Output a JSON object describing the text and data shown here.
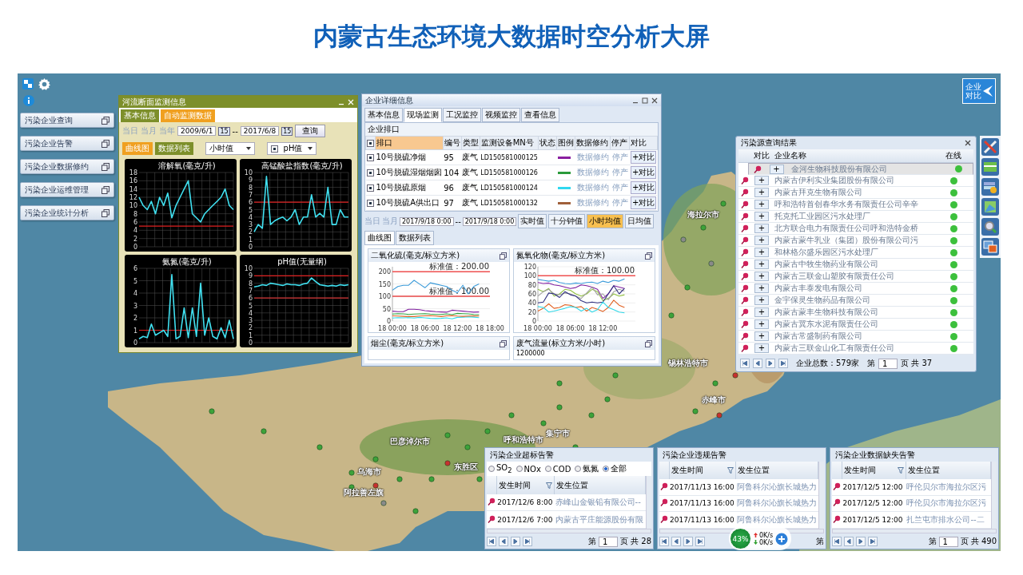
{
  "title": "内蒙古生态环境大数据时空分析大屏",
  "sidebar": {
    "items": [
      {
        "label": "污染企业查询"
      },
      {
        "label": "污染企业告警"
      },
      {
        "label": "污染企业数据修约"
      },
      {
        "label": "污染企业运维管理"
      },
      {
        "label": "污染企业统计分析"
      }
    ]
  },
  "compare_button": {
    "label": "企业对比"
  },
  "map": {
    "labels": [
      "海拉尔市",
      "锡林浩特市",
      "赤峰市",
      "巴彦淖尔市",
      "呼和浩特市",
      "集宁市",
      "东胜区",
      "乌海市",
      "阿拉善左旗"
    ]
  },
  "monitor_window": {
    "title": "河流断面监测信息",
    "tabs": [
      {
        "label": "基本信息",
        "selected": false
      },
      {
        "label": "自动监测数据",
        "selected": true
      }
    ],
    "period_links": [
      "当日",
      "当月",
      "当年"
    ],
    "start_date": "2009/6/1",
    "start_calendar_day": "15",
    "separator": "--",
    "end_date": "2017/6/8",
    "end_calendar_day": "15",
    "query_button": "查询",
    "view_tabs": [
      {
        "label": "曲线图",
        "selected": true
      },
      {
        "label": "数据列表",
        "selected": false
      }
    ],
    "interval_select": "小时值",
    "param_select": {
      "label": "pH值",
      "checked": true
    },
    "charts": [
      {
        "chart_data": {
          "type": "line",
          "title": "溶解氧(毫克/升)",
          "grid": true,
          "ylim": [
            0,
            18
          ],
          "yticks": [
            0,
            2,
            4,
            6,
            8,
            10,
            12,
            14,
            16,
            18
          ],
          "ref_lines": [
            {
              "axis": "y",
              "value": 5
            }
          ],
          "series": [
            {
              "color": "#40e0f0",
              "values": [
                12,
                10,
                9,
                11,
                8,
                12,
                10,
                13,
                7,
                10,
                12,
                14,
                16,
                8,
                7,
                6,
                8,
                9,
                10,
                11,
                12,
                14,
                10,
                9
              ]
            }
          ]
        }
      },
      {
        "chart_data": {
          "type": "line",
          "title": "高锰酸盐指数(毫克/升)",
          "grid": true,
          "ylim": [
            0,
            10
          ],
          "yticks": [
            0,
            1,
            2,
            3,
            4,
            5,
            6,
            7,
            8,
            9,
            10
          ],
          "ref_lines": [
            {
              "axis": "y",
              "value": 6
            }
          ],
          "series": [
            {
              "color": "#40e0f0",
              "values": [
                2,
                3,
                2.5,
                9.5,
                3,
                3.5,
                3.8,
                4,
                3.5,
                4,
                5,
                3,
                4,
                4,
                7,
                4,
                4.5,
                4,
                8,
                3,
                3,
                5,
                4,
                4
              ]
            }
          ]
        }
      },
      {
        "chart_data": {
          "type": "line",
          "title": "氨氮(毫克/升)",
          "grid": true,
          "ylim": [
            0,
            6
          ],
          "yticks": [
            0,
            1,
            2,
            3,
            4,
            5,
            6
          ],
          "ref_lines": [
            {
              "axis": "y",
              "value": 1
            }
          ],
          "series": [
            {
              "color": "#40e0f0",
              "values": [
                0.3,
                0.5,
                0.4,
                1.5,
                0.6,
                0.8,
                1,
                0.5,
                5.5,
                0.3,
                0.5,
                2.8,
                0.4,
                2.8,
                0.5,
                4.8,
                0.6,
                2,
                0.5,
                0.3,
                1.2,
                0.4,
                1.8,
                0.3
              ]
            }
          ]
        }
      },
      {
        "chart_data": {
          "type": "line",
          "title": "pH值(无量纲)",
          "grid": true,
          "ylim": [
            0,
            10
          ],
          "yticks": [
            0,
            1,
            2,
            3,
            4,
            5,
            6,
            7,
            8,
            9,
            10
          ],
          "ref_lines": [
            {
              "axis": "y",
              "value": 6
            },
            {
              "axis": "y",
              "value": 9
            }
          ],
          "series": [
            {
              "color": "#40e0f0",
              "values": [
                7.5,
                7.6,
                7.8,
                7.7,
                8,
                7.9,
                7.8,
                7.7,
                7.9,
                7.8,
                7.8,
                7.7,
                7.9,
                8,
                8.7,
                8.2,
                7.8,
                7.7,
                7.6,
                7.7,
                7.6,
                7.8,
                7.7,
                7.8
              ]
            }
          ]
        }
      }
    ]
  },
  "enterprise_window": {
    "title": "企业详细信息",
    "tabs": [
      {
        "label": "基本信息",
        "selected": false
      },
      {
        "label": "现场监测",
        "selected": true
      },
      {
        "label": "工况监控",
        "selected": false
      },
      {
        "label": "视频监控",
        "selected": false
      },
      {
        "label": "查看信息",
        "selected": false
      }
    ],
    "outlet_title": "企业排口",
    "header_checked": true,
    "columns": [
      "排口",
      "编号",
      "类型",
      "监测设备MN号",
      "状态",
      "图例",
      "数据修约",
      "停产",
      "对比"
    ],
    "rows": [
      {
        "checked": true,
        "outlet": "10号脱硫净烟",
        "code": "95",
        "type": "废气",
        "mn": "LD150581000125",
        "color": "#8a1fa0",
        "repair": "数据修约",
        "stop": "停产",
        "compare": "+对比"
      },
      {
        "checked": true,
        "outlet": "10号脱硫湿烟烟囱",
        "code": "104",
        "type": "废气",
        "mn": "LD150581000126",
        "color": "#2a9a3a",
        "repair": "数据修约",
        "stop": "停产",
        "compare": "+对比"
      },
      {
        "checked": true,
        "outlet": "10号脱硫原烟",
        "code": "96",
        "type": "废气",
        "mn": "LD150581000124",
        "color": "#30d8f0",
        "repair": "数据修约",
        "stop": "停产",
        "compare": "+对比"
      },
      {
        "checked": true,
        "outlet": "10号脱硫A供出口",
        "code": "97",
        "type": "废气",
        "mn": "LD150581000132",
        "color": "#a0603a",
        "repair": "数据修约",
        "stop": "停产",
        "compare": "+对比"
      }
    ],
    "period_links": [
      "当日",
      "当月"
    ],
    "start_date": "2017/9/18 0:00",
    "separator": "--",
    "end_date": "2017/9/18 0:00",
    "interval_buttons": [
      {
        "label": "实时值",
        "selected": false
      },
      {
        "label": "十分钟值",
        "selected": false
      },
      {
        "label": "小时均值",
        "selected": true
      },
      {
        "label": "日均值",
        "selected": false
      }
    ],
    "view_tabs": [
      {
        "label": "曲线图",
        "selected": true
      },
      {
        "label": "数据列表",
        "selected": false
      }
    ],
    "charts": [
      {
        "chart_data": {
          "type": "line",
          "title": "二氧化硫(毫克/标立方米)",
          "grid": true,
          "categories": [
            "18 00:00",
            null,
            null,
            null,
            null,
            null,
            "18 06:00",
            null,
            null,
            null,
            null,
            null,
            "18 12:00",
            null,
            null,
            null,
            null,
            null,
            "18 18:00"
          ],
          "ylim": [
            0,
            220
          ],
          "yticks": [
            0,
            50,
            100,
            150,
            200
          ],
          "ref_lines": [
            {
              "axis": "y",
              "value": 200,
              "label": "标准值：200.00"
            },
            {
              "axis": "y",
              "value": 100,
              "label": "标准值：100.00"
            }
          ],
          "series": [
            {
              "color": "#3a9ad9",
              "values": [
                125,
                140,
                145,
                145,
                165,
                150,
                135,
                155,
                150,
                145,
                140,
                125,
                115,
                145,
                110,
                140,
                150,
                null,
                null
              ]
            },
            {
              "color": "#8020a0",
              "values": [
                40,
                38,
                38,
                48,
                48,
                46,
                42,
                40,
                38,
                37,
                36,
                44,
                42,
                40,
                38,
                36,
                37,
                null,
                null
              ]
            },
            {
              "color": "#30a040",
              "values": [
                28,
                30,
                29,
                27,
                28,
                29,
                30,
                28,
                27,
                27,
                29,
                26,
                31,
                30,
                29,
                27,
                26,
                null,
                null
              ]
            },
            {
              "color": "#30d8e8",
              "values": [
                12,
                14,
                13,
                14,
                12,
                15,
                13,
                11,
                10,
                11,
                13,
                9,
                15,
                16,
                17,
                16,
                14,
                null,
                null
              ]
            },
            {
              "color": "#e06020",
              "values": [
                21,
                20,
                19,
                18,
                18,
                20,
                21,
                22,
                20,
                18,
                21,
                22,
                20,
                19,
                20,
                21,
                20,
                null,
                null
              ]
            }
          ]
        }
      },
      {
        "chart_data": {
          "type": "line",
          "title": "氮氧化物(毫克/标立方米)",
          "grid": true,
          "categories": [
            "18 00:00",
            null,
            null,
            null,
            null,
            null,
            "18 06:00",
            null,
            null,
            null,
            null,
            null,
            "18 12:00",
            null,
            null,
            null,
            null,
            null,
            null
          ],
          "ylim": [
            0,
            120
          ],
          "yticks": [
            0,
            20,
            40,
            60,
            80,
            100,
            120
          ],
          "ref_lines": [
            {
              "axis": "y",
              "value": 100,
              "label": "标准值：100.00"
            }
          ],
          "series": [
            {
              "color": "#3a9ad9",
              "values": [
                92,
                90,
                88,
                90,
                85,
                83,
                82,
                84,
                83,
                85,
                86,
                83,
                88,
                85,
                90,
                88,
                93,
                null,
                null
              ]
            },
            {
              "color": "#8020a0",
              "values": [
                85,
                83,
                84,
                80,
                78,
                75,
                72,
                74,
                80,
                78,
                75,
                70,
                50,
                60,
                78,
                75,
                72,
                null,
                null
              ]
            },
            {
              "color": "#90c040",
              "values": [
                70,
                65,
                72,
                55,
                60,
                70,
                68,
                60,
                55,
                60,
                70,
                65,
                45,
                50,
                60,
                55,
                58,
                null,
                null
              ]
            },
            {
              "color": "#a0a0a0",
              "values": [
                55,
                65,
                70,
                60,
                58,
                62,
                60,
                55,
                50,
                62,
                75,
                58,
                60,
                47,
                65,
                70,
                66,
                null,
                null
              ]
            },
            {
              "color": "#303080",
              "values": [
                40,
                42,
                62,
                60,
                52,
                65,
                58,
                55,
                45,
                40,
                42,
                40,
                42,
                60,
                78,
                60,
                72,
                null,
                null
              ]
            },
            {
              "color": "#e06020",
              "values": [
                22,
                28,
                38,
                28,
                30,
                36,
                35,
                30,
                32,
                22,
                30,
                26,
                21,
                30,
                46,
                35,
                30,
                null,
                null
              ]
            },
            {
              "color": "#30d8e8",
              "values": [
                32,
                30,
                20,
                22,
                25,
                28,
                32,
                30,
                22,
                28,
                20,
                25,
                42,
                30,
                25,
                20,
                18,
                null,
                null
              ]
            }
          ]
        }
      }
    ],
    "more_cards": [
      {
        "title": "烟尘(毫克/标立方米)"
      },
      {
        "title": "废气流量(标立方米/小时)",
        "tick": "1200000"
      }
    ]
  },
  "query_panel": {
    "title": "污染源查询结果",
    "columns": [
      "对比",
      "企业名称",
      "在线"
    ],
    "rows": [
      {
        "name": "金河生物科技股份有限公司",
        "selected": true,
        "online": true
      },
      {
        "name": "内蒙古伊利实业集团股份有限公司",
        "selected": false,
        "online": true
      },
      {
        "name": "内蒙古拜克生物有限公司",
        "selected": false,
        "online": true
      },
      {
        "name": "呼和浩特首创春华水务有限责任公司辛辛",
        "selected": false,
        "online": true
      },
      {
        "name": "托克托工业园区污水处理厂",
        "selected": false,
        "online": true
      },
      {
        "name": "北方联合电力有限责任公司呼和浩特金桥",
        "selected": false,
        "online": true
      },
      {
        "name": "内蒙古蒙牛乳业（集团）股份有限公司污",
        "selected": false,
        "online": true
      },
      {
        "name": "和林格尔盛乐园区污水处理厂",
        "selected": false,
        "online": true
      },
      {
        "name": "内蒙古中牧生物药业有限公司",
        "selected": false,
        "online": true
      },
      {
        "name": "内蒙古三联金山塑胶有限责任公司",
        "selected": false,
        "online": true
      },
      {
        "name": "内蒙古丰泰发电有限公司",
        "selected": false,
        "online": true
      },
      {
        "name": "金宇保灵生物药品有限公司",
        "selected": false,
        "online": true
      },
      {
        "name": "内蒙古蒙丰生物科技有限公司",
        "selected": false,
        "online": true
      },
      {
        "name": "内蒙古冀东水泥有限责任公司",
        "selected": false,
        "online": true
      },
      {
        "name": "内蒙古常盛制药有限公司",
        "selected": false,
        "online": true
      },
      {
        "name": "内蒙古三联金山化工有限责任公司",
        "selected": false,
        "online": true
      }
    ],
    "compare_label": "+",
    "total": "企业总数：579家",
    "page_prefix": "第",
    "page": "1",
    "page_suffix": "页 共 37"
  },
  "alert_panels": [
    {
      "title": "污染企业超标告警",
      "radios": [
        {
          "label": "SO$_{2}$",
          "selected": false
        },
        {
          "label": "NOx",
          "selected": false
        },
        {
          "label": "COD",
          "selected": false
        },
        {
          "label": "氨氮",
          "selected": false
        },
        {
          "label": "全部",
          "selected": true
        }
      ],
      "columns": [
        "发生时间",
        "发生位置"
      ],
      "rows": [
        [
          "2017/12/6 8:00",
          "赤峰山金银铅有限公司--"
        ],
        [
          "2017/12/6 7:00",
          "内蒙古平庄能源股份有限"
        ]
      ],
      "page_prefix": "第",
      "page": "1",
      "page_suffix": "页 共 28"
    },
    {
      "title": "污染企业违规告警",
      "columns": [
        "发生时间",
        "发生位置"
      ],
      "rows": [
        [
          "2017/11/13 16:00",
          "阿鲁科尔沁旗长城热力"
        ],
        [
          "2017/11/13 16:00",
          "阿鲁科尔沁旗长城热力"
        ],
        [
          "2017/11/13 16:00",
          "阿鲁科尔沁旗长城热力"
        ]
      ],
      "page_prefix": "第"
    },
    {
      "title": "污染企业数据缺失告警",
      "columns": [
        "发生时间",
        "发生位置"
      ],
      "rows": [
        [
          "2017/12/5 12:00",
          "呼伦贝尔市海拉尔区污"
        ],
        [
          "2017/12/5 12:00",
          "呼伦贝尔市海拉尔区污"
        ],
        [
          "2017/12/5 12:00",
          "扎兰屯市排水公司--二"
        ]
      ],
      "page_prefix": "第",
      "page": "1",
      "page_suffix": "页 共 490"
    }
  ],
  "speed_widget": {
    "percent": "43%",
    "up": "0K/s",
    "down": "0K/s"
  }
}
